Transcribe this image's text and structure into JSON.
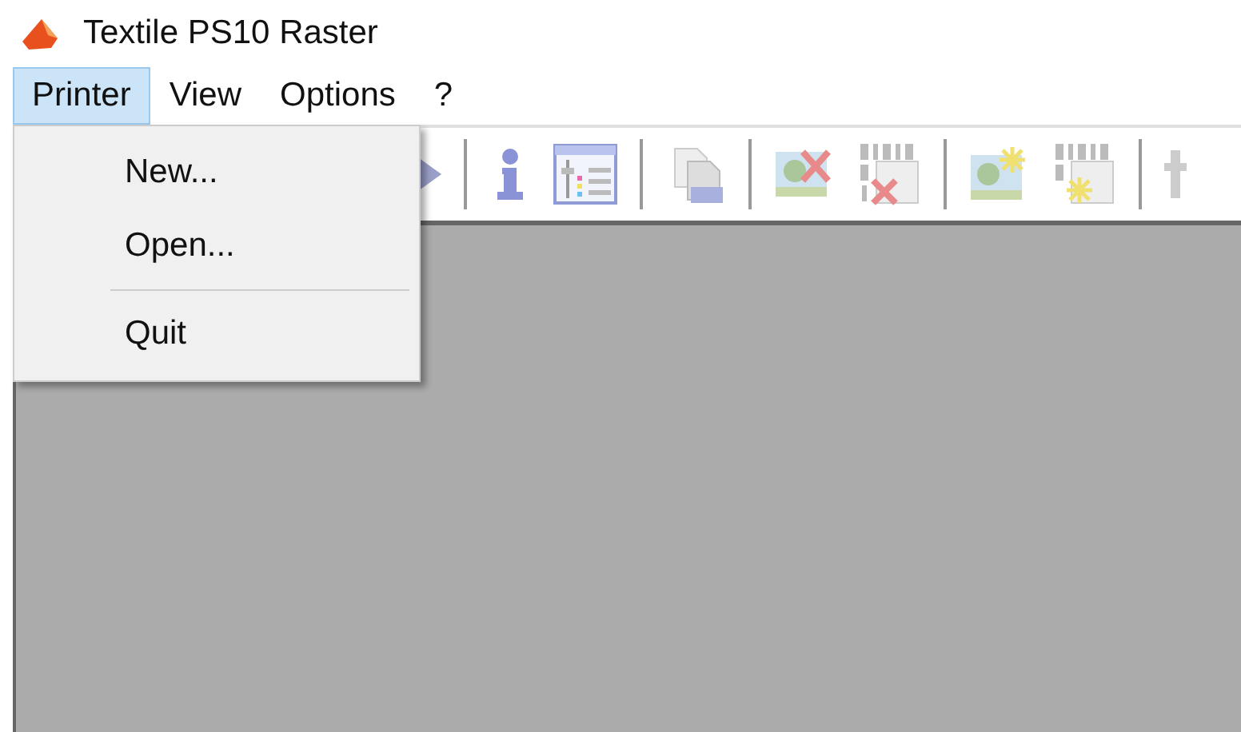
{
  "window": {
    "title": "Textile PS10 Raster"
  },
  "menu": [
    {
      "label": "Printer",
      "selected": true
    },
    {
      "label": "View",
      "selected": false
    },
    {
      "label": "Options",
      "selected": false
    },
    {
      "label": "?",
      "selected": false
    }
  ],
  "dropdown": [
    {
      "kind": "item",
      "label": "New..."
    },
    {
      "kind": "item",
      "label": "Open..."
    },
    {
      "kind": "separator"
    },
    {
      "kind": "item",
      "label": "Quit"
    }
  ]
}
